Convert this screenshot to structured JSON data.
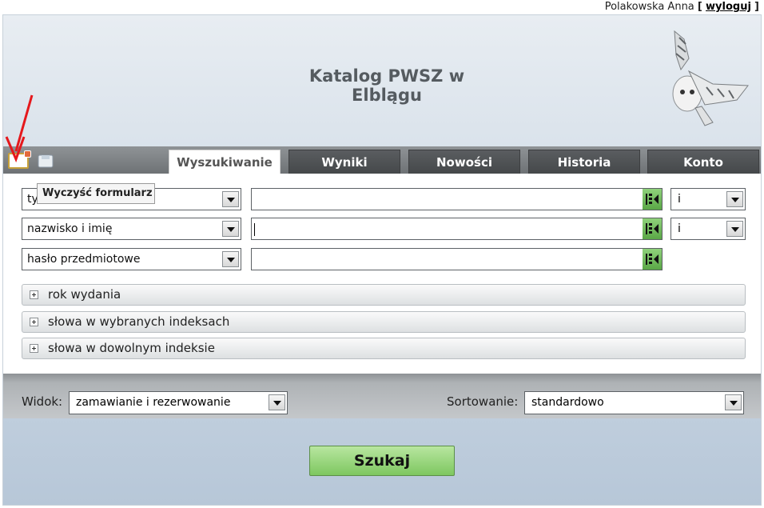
{
  "user": {
    "name": "Polakowska Anna",
    "bracket_open": "[",
    "logout_label": "wyloguj",
    "bracket_close": "]"
  },
  "header": {
    "title": "Katalog PWSZ w Elblągu"
  },
  "tooltip": "Wyczyść formularz",
  "tabs": [
    {
      "label": "Wyszukiwanie",
      "active": true
    },
    {
      "label": "Wyniki"
    },
    {
      "label": "Nowości"
    },
    {
      "label": "Historia"
    },
    {
      "label": "Konto"
    }
  ],
  "search_rows": [
    {
      "field": "tytuł",
      "value": "",
      "operator": "i"
    },
    {
      "field": "nazwisko i imię",
      "value": "",
      "operator": "i"
    },
    {
      "field": "hasło przedmiotowe",
      "value": ""
    }
  ],
  "sections": [
    "rok wydania",
    "słowa w wybranych indeksach",
    "słowa w dowolnym indeksie"
  ],
  "options": {
    "view_label": "Widok:",
    "view_value": "zamawianie i rezerwowanie",
    "sort_label": "Sortowanie:",
    "sort_value": "standardowo"
  },
  "search_button": "Szukaj",
  "icons": [
    "clear-form-icon",
    "save-icon",
    "keyboard-icon",
    "owl-logo",
    "annotation-arrow"
  ],
  "colors": {
    "accent_green": "#7ec760",
    "tab_dark": "#45484a",
    "annotation_red": "#e5181c"
  }
}
